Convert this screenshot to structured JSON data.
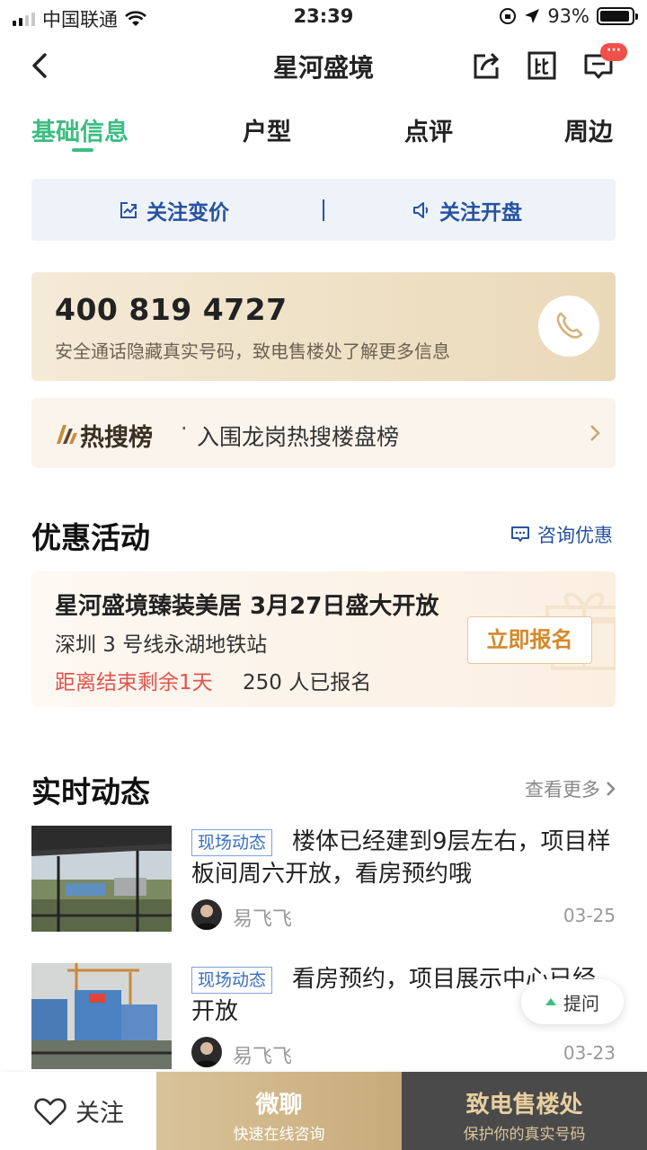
{
  "status_bar": {
    "carrier": "中国联通",
    "time": "23:39",
    "battery": "93%",
    "battery_level": 0.93
  },
  "nav": {
    "title": "星河盛境",
    "message_badge": "···"
  },
  "tabs": [
    {
      "label": "基础信息",
      "active": true
    },
    {
      "label": "户型",
      "active": false
    },
    {
      "label": "点评",
      "active": false
    },
    {
      "label": "周边",
      "active": false
    }
  ],
  "follow": {
    "price_label": "关注变价",
    "opening_label": "关注开盘"
  },
  "phone": {
    "number": "400 819 4727",
    "desc": "安全通话隐藏真实号码，致电售楼处了解更多信息"
  },
  "hot_search": {
    "title": "热搜榜",
    "dot": "·",
    "text": "入围龙岗热搜楼盘榜"
  },
  "promotions": {
    "section_title": "优惠活动",
    "consult_label": "咨询优惠",
    "card": {
      "title": "星河盛境臻装美居 3月27日盛大开放",
      "subtitle": "深圳 3 号线永湖地铁站",
      "countdown": "距离结束剩余1天",
      "signup_count": "250 人已报名",
      "button": "立即报名"
    }
  },
  "news": {
    "section_title": "实时动态",
    "see_more": "查看更多",
    "items": [
      {
        "tag": "现场动态",
        "text": "楼体已经建到9层左右，项目样板间周六开放，看房预约哦",
        "author": "易飞飞",
        "date": "03-25"
      },
      {
        "tag": "现场动态",
        "text": "看房预约，项目展示中心已经开放",
        "author": "易飞飞",
        "date": "03-23"
      }
    ]
  },
  "ask_button": "提问",
  "bottom": {
    "fav_label": "关注",
    "chat_main": "微聊",
    "chat_sub": "快速在线咨询",
    "call_main": "致电售楼处",
    "call_sub": "保护你的真实号码"
  },
  "colors": {
    "accent_green": "#3ebd82",
    "link_blue": "#2752a0",
    "countdown_red": "#e0554d",
    "gold": "#c7ab7a"
  }
}
